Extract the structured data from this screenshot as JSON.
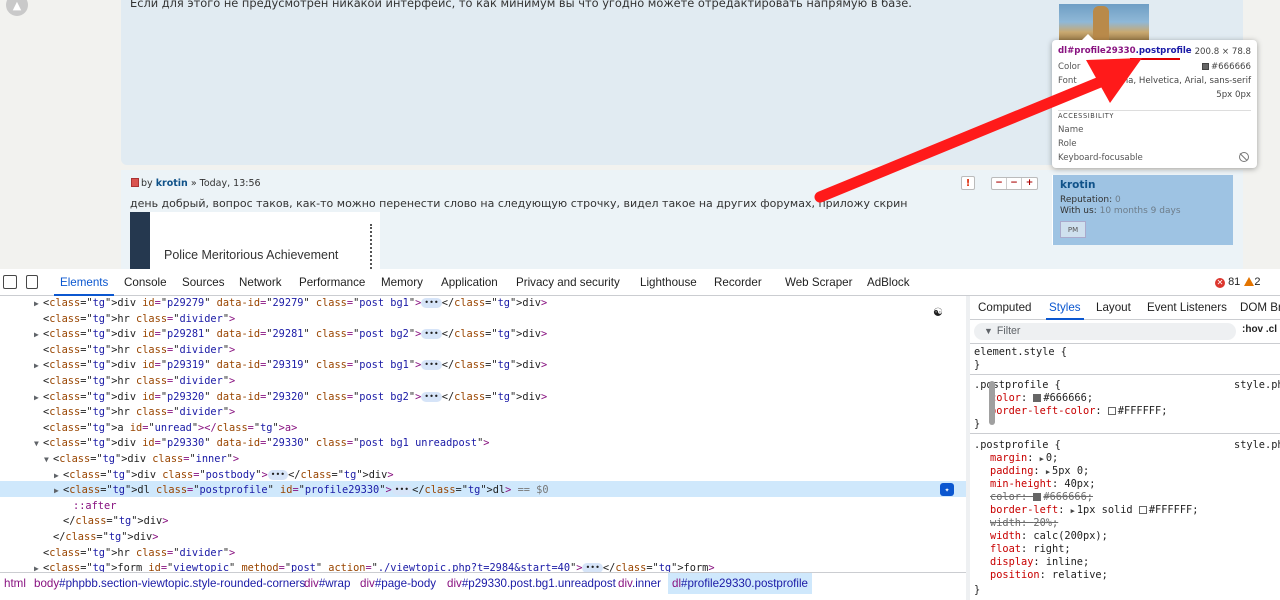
{
  "forum": {
    "post1_text": "Если для этого не предусмотрен никакой интерфейс, то как минимум вы что угодно можете отредактировать напрямую в базе.",
    "post2": {
      "by": "by",
      "author": "krotin",
      "date": "» Today, 13:56",
      "text": "день добрый, вопрос таков, как-то можно перенести слово на следующую строчку, видел такое на других форумах, приложу скрин",
      "image_caption": "Police Meritorious Achievement",
      "report_label": "!",
      "buttons": [
        "−",
        "−",
        "+"
      ]
    },
    "profile": {
      "name": "krotin",
      "reputation_label": "Reputation:",
      "reputation_value": "0",
      "with_us_label": "With us:",
      "with_us_value": "10 months 9 days",
      "pm_label": "PM"
    }
  },
  "tooltip": {
    "selector_tag": "dl#profile29330",
    "selector_class": ".postprofile",
    "size": "200.8 × 78.8",
    "color_label": "Color",
    "color_value": "#666666",
    "font_label": "Font",
    "font_value": "ana, Helvetica, Arial, sans-serif",
    "padding_value": "5px 0px",
    "accessibility_heading": "ACCESSIBILITY",
    "name_label": "Name",
    "role_label": "Role",
    "keyboard_label": "Keyboard-focusable"
  },
  "devtools": {
    "tabs": [
      "Elements",
      "Console",
      "Sources",
      "Network",
      "Performance",
      "Memory",
      "Application",
      "Privacy and security",
      "Lighthouse",
      "Recorder",
      "Web Scraper",
      "AdBlock"
    ],
    "active_tab": "Elements",
    "errors": "81",
    "warnings": "2",
    "dom_lines": [
      {
        "indent": 1,
        "toggle": "▶",
        "html": "<div id=\"p29279\" data-id=\"29279\" class=\"post bg1\">",
        "ellipsis": true,
        "close": "</div>"
      },
      {
        "indent": 1,
        "toggle": "",
        "html": "<hr class=\"divider\">",
        "ellipsis": false,
        "close": ""
      },
      {
        "indent": 1,
        "toggle": "▶",
        "html": "<div id=\"p29281\" data-id=\"29281\" class=\"post bg2\">",
        "ellipsis": true,
        "close": "</div>"
      },
      {
        "indent": 1,
        "toggle": "",
        "html": "<hr class=\"divider\">",
        "ellipsis": false,
        "close": ""
      },
      {
        "indent": 1,
        "toggle": "▶",
        "html": "<div id=\"p29319\" data-id=\"29319\" class=\"post bg1\">",
        "ellipsis": true,
        "close": "</div>"
      },
      {
        "indent": 1,
        "toggle": "",
        "html": "<hr class=\"divider\">",
        "ellipsis": false,
        "close": ""
      },
      {
        "indent": 1,
        "toggle": "▶",
        "html": "<div id=\"p29320\" data-id=\"29320\" class=\"post bg2\">",
        "ellipsis": true,
        "close": "</div>"
      },
      {
        "indent": 1,
        "toggle": "",
        "html": "<hr class=\"divider\">",
        "ellipsis": false,
        "close": ""
      },
      {
        "indent": 1,
        "toggle": "",
        "html": "<a id=\"unread\"></a>",
        "ellipsis": false,
        "close": ""
      },
      {
        "indent": 1,
        "toggle": "▼",
        "html": "<div id=\"p29330\" data-id=\"29330\" class=\"post bg1 unreadpost\">",
        "ellipsis": false,
        "close": ""
      },
      {
        "indent": 2,
        "toggle": "▼",
        "html": "<div class=\"inner\">",
        "ellipsis": false,
        "close": ""
      },
      {
        "indent": 3,
        "toggle": "▶",
        "html": "<div class=\"postbody\">",
        "ellipsis": true,
        "close": "</div>"
      },
      {
        "indent": 3,
        "toggle": "▶",
        "html": "<dl class=\"postprofile\" id=\"profile29330\">",
        "ellipsis": true,
        "close": "</dl> == $0"
      },
      {
        "indent": 4,
        "toggle": "",
        "html": "::after",
        "ellipsis": false,
        "close": ""
      },
      {
        "indent": 3,
        "toggle": "",
        "html": "</div>",
        "ellipsis": false,
        "close": ""
      },
      {
        "indent": 2,
        "toggle": "",
        "html": "</div>",
        "ellipsis": false,
        "close": ""
      },
      {
        "indent": 1,
        "toggle": "",
        "html": "<hr class=\"divider\">",
        "ellipsis": false,
        "close": ""
      },
      {
        "indent": 1,
        "toggle": "▶",
        "html": "<form id=\"viewtopic\" method=\"post\" action=\"./viewtopic.php?t=2984&start=40\">",
        "ellipsis": true,
        "close": "</form>"
      }
    ],
    "breadcrumbs": [
      {
        "tag": "html",
        "rest": ""
      },
      {
        "tag": "body",
        "rest": "#phpbb.section-viewtopic.style-rounded-corners"
      },
      {
        "tag": "div",
        "rest": "#wrap"
      },
      {
        "tag": "div",
        "rest": "#page-body"
      },
      {
        "tag": "div",
        "rest": "#p29330.post.bg1.unreadpost"
      },
      {
        "tag": "div",
        "rest": ".inner"
      },
      {
        "tag": "dl",
        "rest": "#profile29330.postprofile"
      }
    ],
    "styles_tabs": [
      "Computed",
      "Styles",
      "Layout",
      "Event Listeners",
      "DOM Br"
    ],
    "styles_active": "Styles",
    "filter_placeholder": "Filter",
    "hov_label": ":hov  .cl",
    "element_style": "element.style {",
    "rule1": {
      "selector": ".postprofile {",
      "source": "style.php",
      "props": [
        {
          "name": "color",
          "value": "#666666",
          "swatch": "#666666",
          "strike": false
        },
        {
          "name": "border-left-color",
          "value": "#FFFFFF",
          "swatch": "#FFFFFF",
          "strike": false
        }
      ]
    },
    "rule2": {
      "selector": ".postprofile {",
      "source": "style.php",
      "props": [
        {
          "name": "margin",
          "value": "0;",
          "tri": true,
          "strike": false
        },
        {
          "name": "padding",
          "value": "5px 0;",
          "tri": true,
          "strike": false
        },
        {
          "name": "min-height",
          "value": "40px;",
          "strike": false
        },
        {
          "name": "color",
          "value": "#666666;",
          "swatch": "#666666",
          "strike": true
        },
        {
          "name": "border-left",
          "value": "1px solid",
          "tri": true,
          "swatch2": "#FFFFFF",
          "value2": "#FFFFFF;",
          "strike": false
        },
        {
          "name": "width",
          "value": "20%;",
          "strike": true
        },
        {
          "name": "width",
          "value": "calc(200px);",
          "strike": false
        },
        {
          "name": "float",
          "value": "right;",
          "strike": false
        },
        {
          "name": "display",
          "value": "inline;",
          "strike": false
        },
        {
          "name": "position",
          "value": "relative;",
          "strike": false
        }
      ]
    }
  }
}
